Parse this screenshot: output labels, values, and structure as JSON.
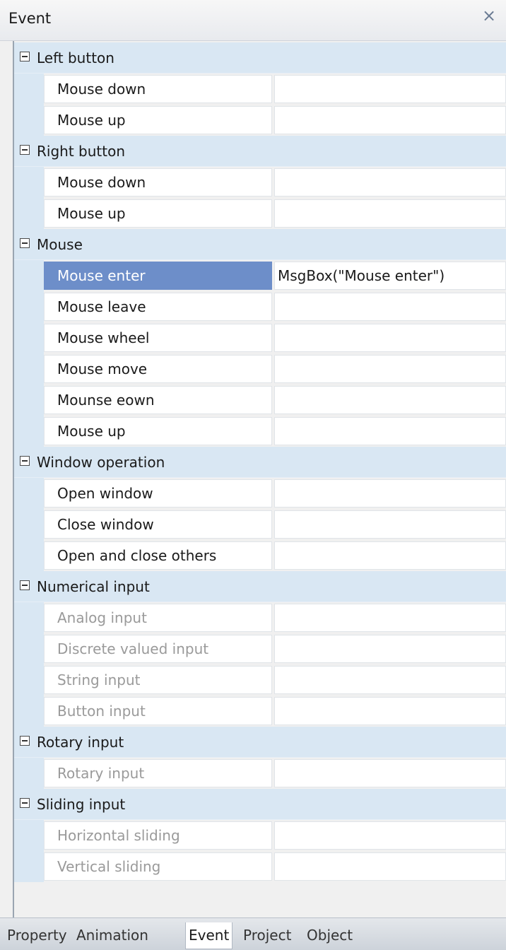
{
  "panel": {
    "title": "Event",
    "close_glyph": "×"
  },
  "categories": [
    {
      "label": "Left button",
      "items": [
        {
          "name": "Mouse down",
          "value": ""
        },
        {
          "name": "Mouse up",
          "value": ""
        }
      ]
    },
    {
      "label": "Right button",
      "items": [
        {
          "name": "Mouse down",
          "value": ""
        },
        {
          "name": "Mouse up",
          "value": ""
        }
      ]
    },
    {
      "label": "Mouse",
      "items": [
        {
          "name": "Mouse enter",
          "value": "MsgBox(\"Mouse enter\")",
          "selected": true
        },
        {
          "name": "Mouse leave",
          "value": ""
        },
        {
          "name": "Mouse wheel",
          "value": ""
        },
        {
          "name": "Mouse move",
          "value": ""
        },
        {
          "name": "Mounse eown",
          "value": ""
        },
        {
          "name": "Mouse up",
          "value": ""
        }
      ]
    },
    {
      "label": "Window operation",
      "items": [
        {
          "name": "Open window",
          "value": ""
        },
        {
          "name": "Close window",
          "value": ""
        },
        {
          "name": "Open and close others",
          "value": ""
        }
      ]
    },
    {
      "label": "Numerical input",
      "items": [
        {
          "name": "Analog input",
          "value": "",
          "disabled": true
        },
        {
          "name": "Discrete valued input",
          "value": "",
          "disabled": true
        },
        {
          "name": "String input",
          "value": "",
          "disabled": true
        },
        {
          "name": "Button input",
          "value": "",
          "disabled": true
        }
      ]
    },
    {
      "label": "Rotary input",
      "items": [
        {
          "name": "Rotary input",
          "value": "",
          "disabled": true
        }
      ]
    },
    {
      "label": "Sliding input",
      "items": [
        {
          "name": "Horizontal sliding",
          "value": "",
          "disabled": true
        },
        {
          "name": "Vertical sliding",
          "value": "",
          "disabled": true
        }
      ]
    }
  ],
  "tabs": [
    {
      "label": "Property",
      "active": false
    },
    {
      "label": "Animation",
      "active": false
    },
    {
      "label": "Event",
      "active": true
    },
    {
      "label": "Project",
      "active": false
    },
    {
      "label": "Object",
      "active": false
    }
  ],
  "colors": {
    "category_bg": "#d9e7f3",
    "selected_bg": "#6d8ec9",
    "disabled_text": "#9a9a9a"
  }
}
